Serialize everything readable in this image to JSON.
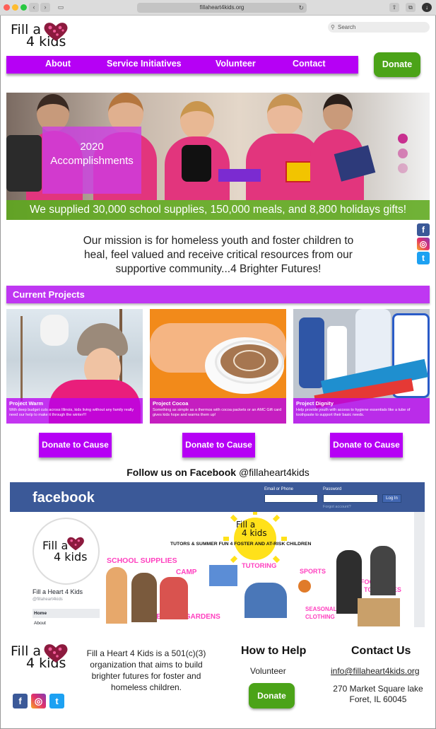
{
  "browser": {
    "url": "fillaheart4kids.org",
    "reload_glyph": "↻"
  },
  "logo": {
    "line1": "Fill a",
    "line2": "4 kids"
  },
  "search": {
    "placeholder": "Search",
    "icon": "search-icon"
  },
  "nav": {
    "items": [
      {
        "label": "About"
      },
      {
        "label": "Service Initiatives"
      },
      {
        "label": "Volunteer"
      },
      {
        "label": "Contact"
      }
    ],
    "donate_label": "Donate"
  },
  "hero": {
    "card_title": "2020",
    "card_subtitle": "Accomplishments",
    "caption": "We supplied 30,000 school supplies, 150,000 meals, and 8,800 holidays gifts!"
  },
  "mission": "Our mission is for homeless youth and foster children to heal, feel valued and receive critical resources from our supportive community...4 Brighter Futures!",
  "social": {
    "facebook": "f",
    "instagram": "◎",
    "twitter": "t"
  },
  "projects_section": {
    "title": "Current Projects",
    "projects": [
      {
        "title": "Project Warm",
        "desc": "With deep budget cuts across Illinois, kids living without any family really need our help to make it through the winter!!!",
        "button": "Donate to Cause"
      },
      {
        "title": "Project Cocoa",
        "desc": "Something as simple as a thermos with cocoa packets or an AMC Gift card gives kids hope and warms them up!",
        "button": "Donate to Cause"
      },
      {
        "title": "Project Dignity",
        "desc": "Help provide youth with access to hygiene essentials like a tube of toothpaste to support their basic needs.",
        "button": "Donate to Cause"
      }
    ]
  },
  "follow": {
    "prefix": "Follow us on Facebook",
    "handle": "@fillaheart4kids"
  },
  "facebook_embed": {
    "logo": "facebook",
    "email_label": "Email or Phone",
    "password_label": "Password",
    "login_label": "Log In",
    "forgot": "Forgot account?",
    "page_name": "Fill a Heart 4 Kids",
    "page_handle": "@fillaheart4kids",
    "menu": [
      "Home",
      "About"
    ],
    "cover": {
      "logo_line1": "Fill a",
      "logo_line2": "4 kids",
      "tagline": "TUTORS & SUMMER FUN 4 FOSTER AND AT-RISK CHILDREN",
      "tags": [
        "SCHOOL SUPPLIES",
        "CAMP",
        "TUTORING",
        "SPORTS",
        "FOOD",
        "TOILETRIES",
        "SEASONAL",
        "CLOTHING",
        "HEALING GARDENS"
      ]
    }
  },
  "footer": {
    "description": "Fill a Heart 4 Kids is a 501(c)(3) organization that aims to build brighter futures for foster and homeless children.",
    "how_to_help": {
      "title": "How to Help",
      "volunteer": "Volunteer",
      "donate": "Donate"
    },
    "contact": {
      "title": "Contact Us",
      "email": "info@fillaheart4kids.org",
      "address_line1": "270 Market Square lake",
      "address_line2": "Foret, IL 60045"
    }
  },
  "colors": {
    "purple": "#b600f5",
    "green": "#4ba318",
    "pink_heart": "#d8316f",
    "facebook_blue": "#3b5998"
  }
}
